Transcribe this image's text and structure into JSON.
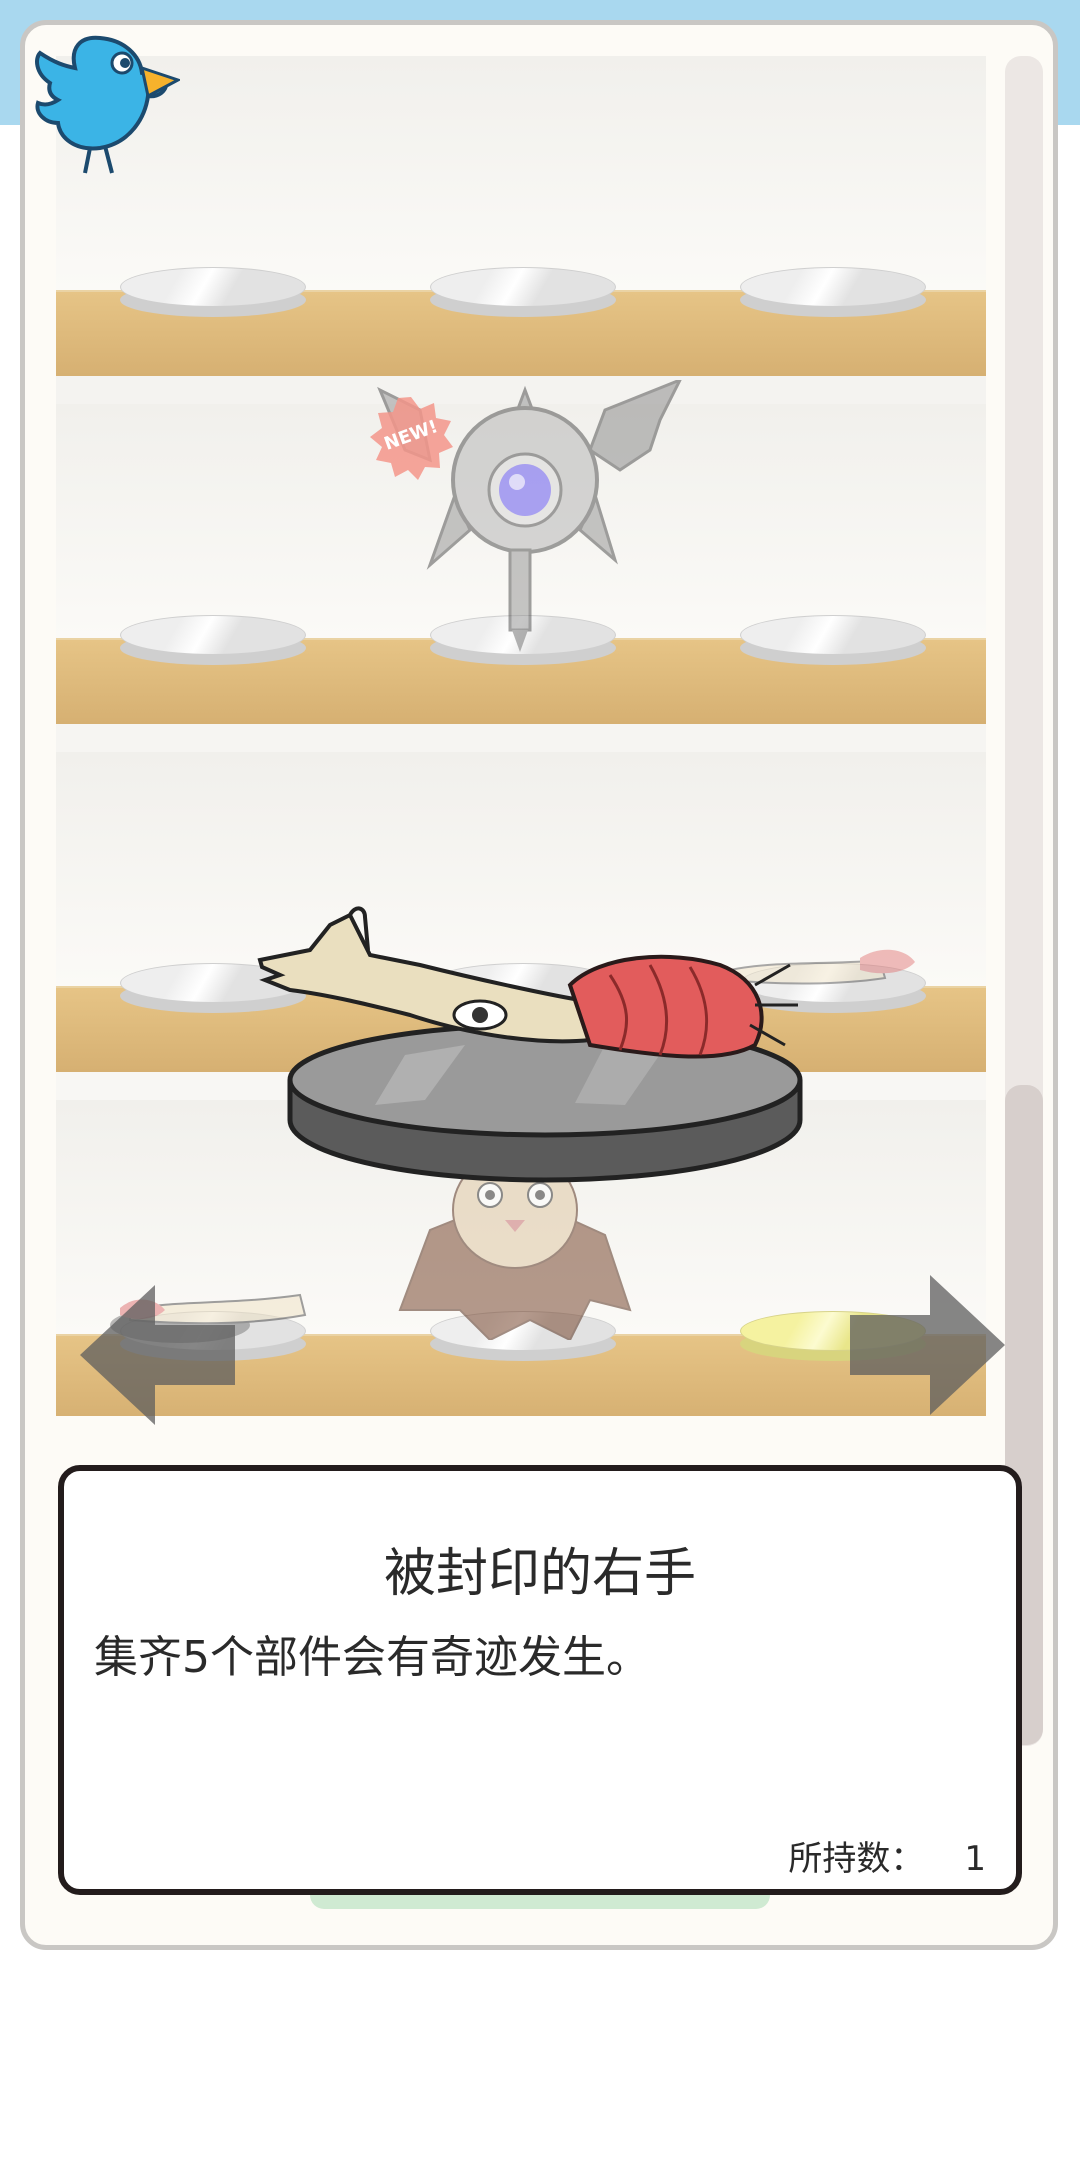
{
  "item": {
    "name": "被封印的右手",
    "description": "集齐5个部件会有奇迹发生。",
    "count_label": "所持数：",
    "count_value": "1"
  },
  "badge": {
    "text": "NEW!"
  },
  "icons": {
    "bird": "bird-icon",
    "prev": "arrow-left-icon",
    "next": "arrow-right-icon"
  },
  "colors": {
    "shelf_wood": "#d8b274",
    "panel_bg": "#fdfbf6",
    "dialog_border": "#231c1c",
    "bird_blue": "#3bb4e6",
    "badge_red": "#f08a7a"
  }
}
